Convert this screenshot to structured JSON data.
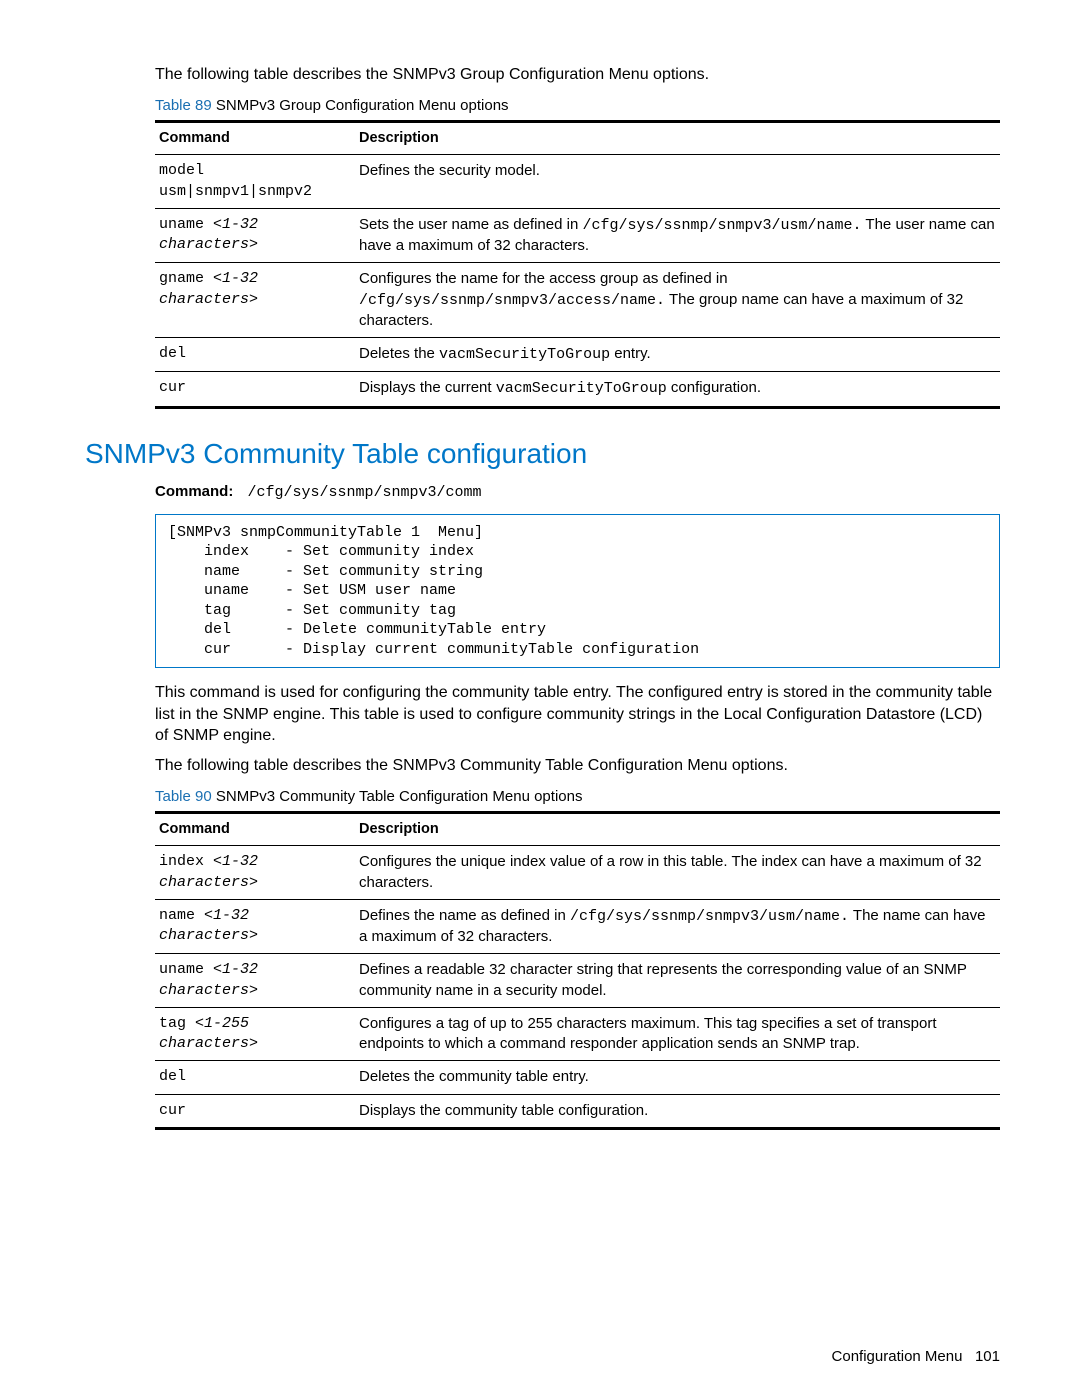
{
  "intro1": "The following table describes the SNMPv3 Group Configuration Menu options.",
  "table89": {
    "label": "Table 89",
    "title": " SNMPv3 Group Configuration Menu options",
    "headers": {
      "c1": "Command",
      "c2": "Description"
    },
    "rows": [
      {
        "cmd_plain": "model\nusm|snmpv1|snmpv2",
        "desc_parts": [
          {
            "t": "text",
            "v": "Defines the security model."
          }
        ]
      },
      {
        "cmd_plain": "uname ",
        "cmd_ital": "<1-32\ncharacters>",
        "desc_parts": [
          {
            "t": "text",
            "v": "Sets the user name as defined in "
          },
          {
            "t": "mono",
            "v": "/cfg/sys/ssnmp/snmpv3/usm/name."
          },
          {
            "t": "text",
            "v": " The user name can have a maximum of 32 characters."
          }
        ]
      },
      {
        "cmd_plain": "gname ",
        "cmd_ital": "<1-32\ncharacters>",
        "desc_parts": [
          {
            "t": "text",
            "v": "Configures the name for the access group as defined in "
          },
          {
            "t": "mono",
            "v": "/cfg/sys/ssnmp/snmpv3/access/name."
          },
          {
            "t": "text",
            "v": " The group name can have a maximum of 32 characters."
          }
        ]
      },
      {
        "cmd_plain": "del",
        "desc_parts": [
          {
            "t": "text",
            "v": "Deletes the "
          },
          {
            "t": "mono",
            "v": "vacmSecurityToGroup"
          },
          {
            "t": "text",
            "v": " entry."
          }
        ]
      },
      {
        "cmd_plain": "cur",
        "desc_parts": [
          {
            "t": "text",
            "v": "Displays the current "
          },
          {
            "t": "mono",
            "v": "vacmSecurityToGroup"
          },
          {
            "t": "text",
            "v": " configuration."
          }
        ]
      }
    ]
  },
  "section_heading": "SNMPv3 Community Table configuration",
  "cmd_label": "Command:",
  "cmd_path": "/cfg/sys/ssnmp/snmpv3/comm",
  "code_box": "[SNMPv3 snmpCommunityTable 1  Menu]\n    index    - Set community index\n    name     - Set community string\n    uname    - Set USM user name\n    tag      - Set community tag\n    del      - Delete communityTable entry\n    cur      - Display current communityTable configuration",
  "desc1": "This command is used for configuring the community table entry. The configured entry is stored in the community table list in the SNMP engine. This table is used to configure community strings in the Local Configuration Datastore (LCD) of SNMP engine.",
  "desc2": "The following table describes the SNMPv3 Community Table Configuration Menu options.",
  "table90": {
    "label": "Table 90",
    "title": " SNMPv3 Community Table Configuration Menu options",
    "headers": {
      "c1": "Command",
      "c2": "Description"
    },
    "rows": [
      {
        "cmd_plain": "index ",
        "cmd_ital": "<1-32\ncharacters>",
        "desc_parts": [
          {
            "t": "text",
            "v": "Configures the unique index value of a row in this table. The index can have a maximum of 32 characters."
          }
        ]
      },
      {
        "cmd_plain": "name ",
        "cmd_ital": "<1-32\ncharacters>",
        "desc_parts": [
          {
            "t": "text",
            "v": "Defines the name as defined in "
          },
          {
            "t": "mono",
            "v": "/cfg/sys/ssnmp/snmpv3/usm/name."
          },
          {
            "t": "text",
            "v": " The name can have a maximum of 32 characters."
          }
        ]
      },
      {
        "cmd_plain": "uname ",
        "cmd_ital": "<1-32\ncharacters>",
        "desc_parts": [
          {
            "t": "text",
            "v": "Defines a readable 32 character string that represents the corresponding value of an SNMP community name in a security model."
          }
        ]
      },
      {
        "cmd_plain": "tag ",
        "cmd_ital": "<1-255\ncharacters>",
        "desc_parts": [
          {
            "t": "text",
            "v": "Configures a tag of up to 255 characters maximum. This tag specifies a set of transport endpoints to which a command responder application sends an SNMP trap."
          }
        ]
      },
      {
        "cmd_plain": "del",
        "desc_parts": [
          {
            "t": "text",
            "v": "Deletes the community table entry."
          }
        ]
      },
      {
        "cmd_plain": "cur",
        "desc_parts": [
          {
            "t": "text",
            "v": "Displays the community table configuration."
          }
        ]
      }
    ]
  },
  "footer": {
    "section": "Configuration Menu",
    "page": "101"
  }
}
